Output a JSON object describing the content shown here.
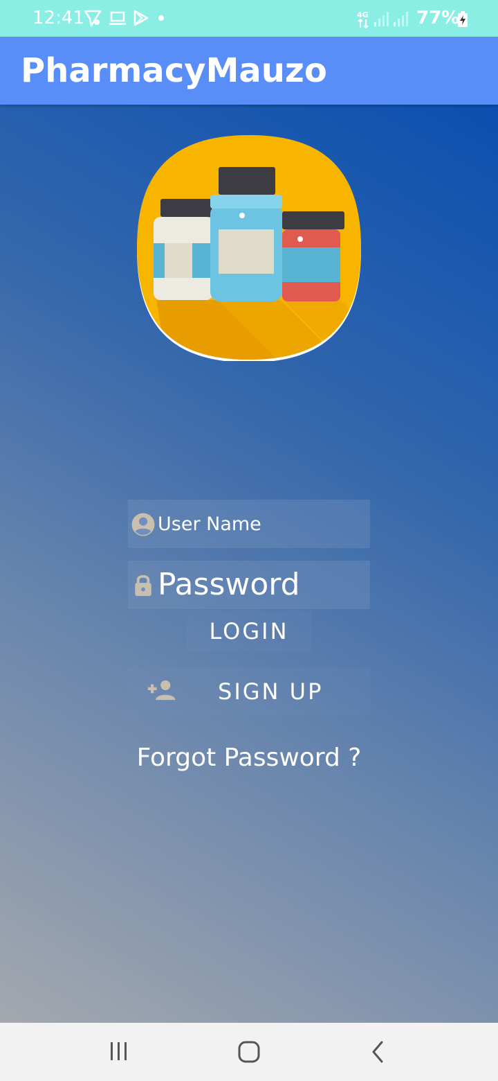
{
  "status_bar": {
    "time": "12:41",
    "battery": "77%",
    "network": "4G",
    "icons": [
      "send-icon",
      "laptop-icon",
      "play-store-icon",
      "dot-icon",
      "signal-icon",
      "signal-icon",
      "battery-charging-icon"
    ]
  },
  "app_bar": {
    "title": "PharmacyMauzo"
  },
  "login_form": {
    "username_placeholder": "User Name",
    "password_placeholder": "Password",
    "login_label": "LOGIN",
    "signup_label": "SIGN UP",
    "forgot_label": "Forgot Password ?"
  },
  "icons": {
    "username": "account-circle-icon",
    "password": "lock-icon",
    "signup": "person-add-icon",
    "logo": "medicine-bottles-logo"
  },
  "nav_bar": {
    "buttons": [
      "recents-icon",
      "home-icon",
      "back-icon"
    ]
  },
  "colors": {
    "status_bar": "#8aeee5",
    "app_bar": "#598ef8",
    "icon_tint": "#c8bfaf",
    "logo_bg": "#f7b500"
  }
}
